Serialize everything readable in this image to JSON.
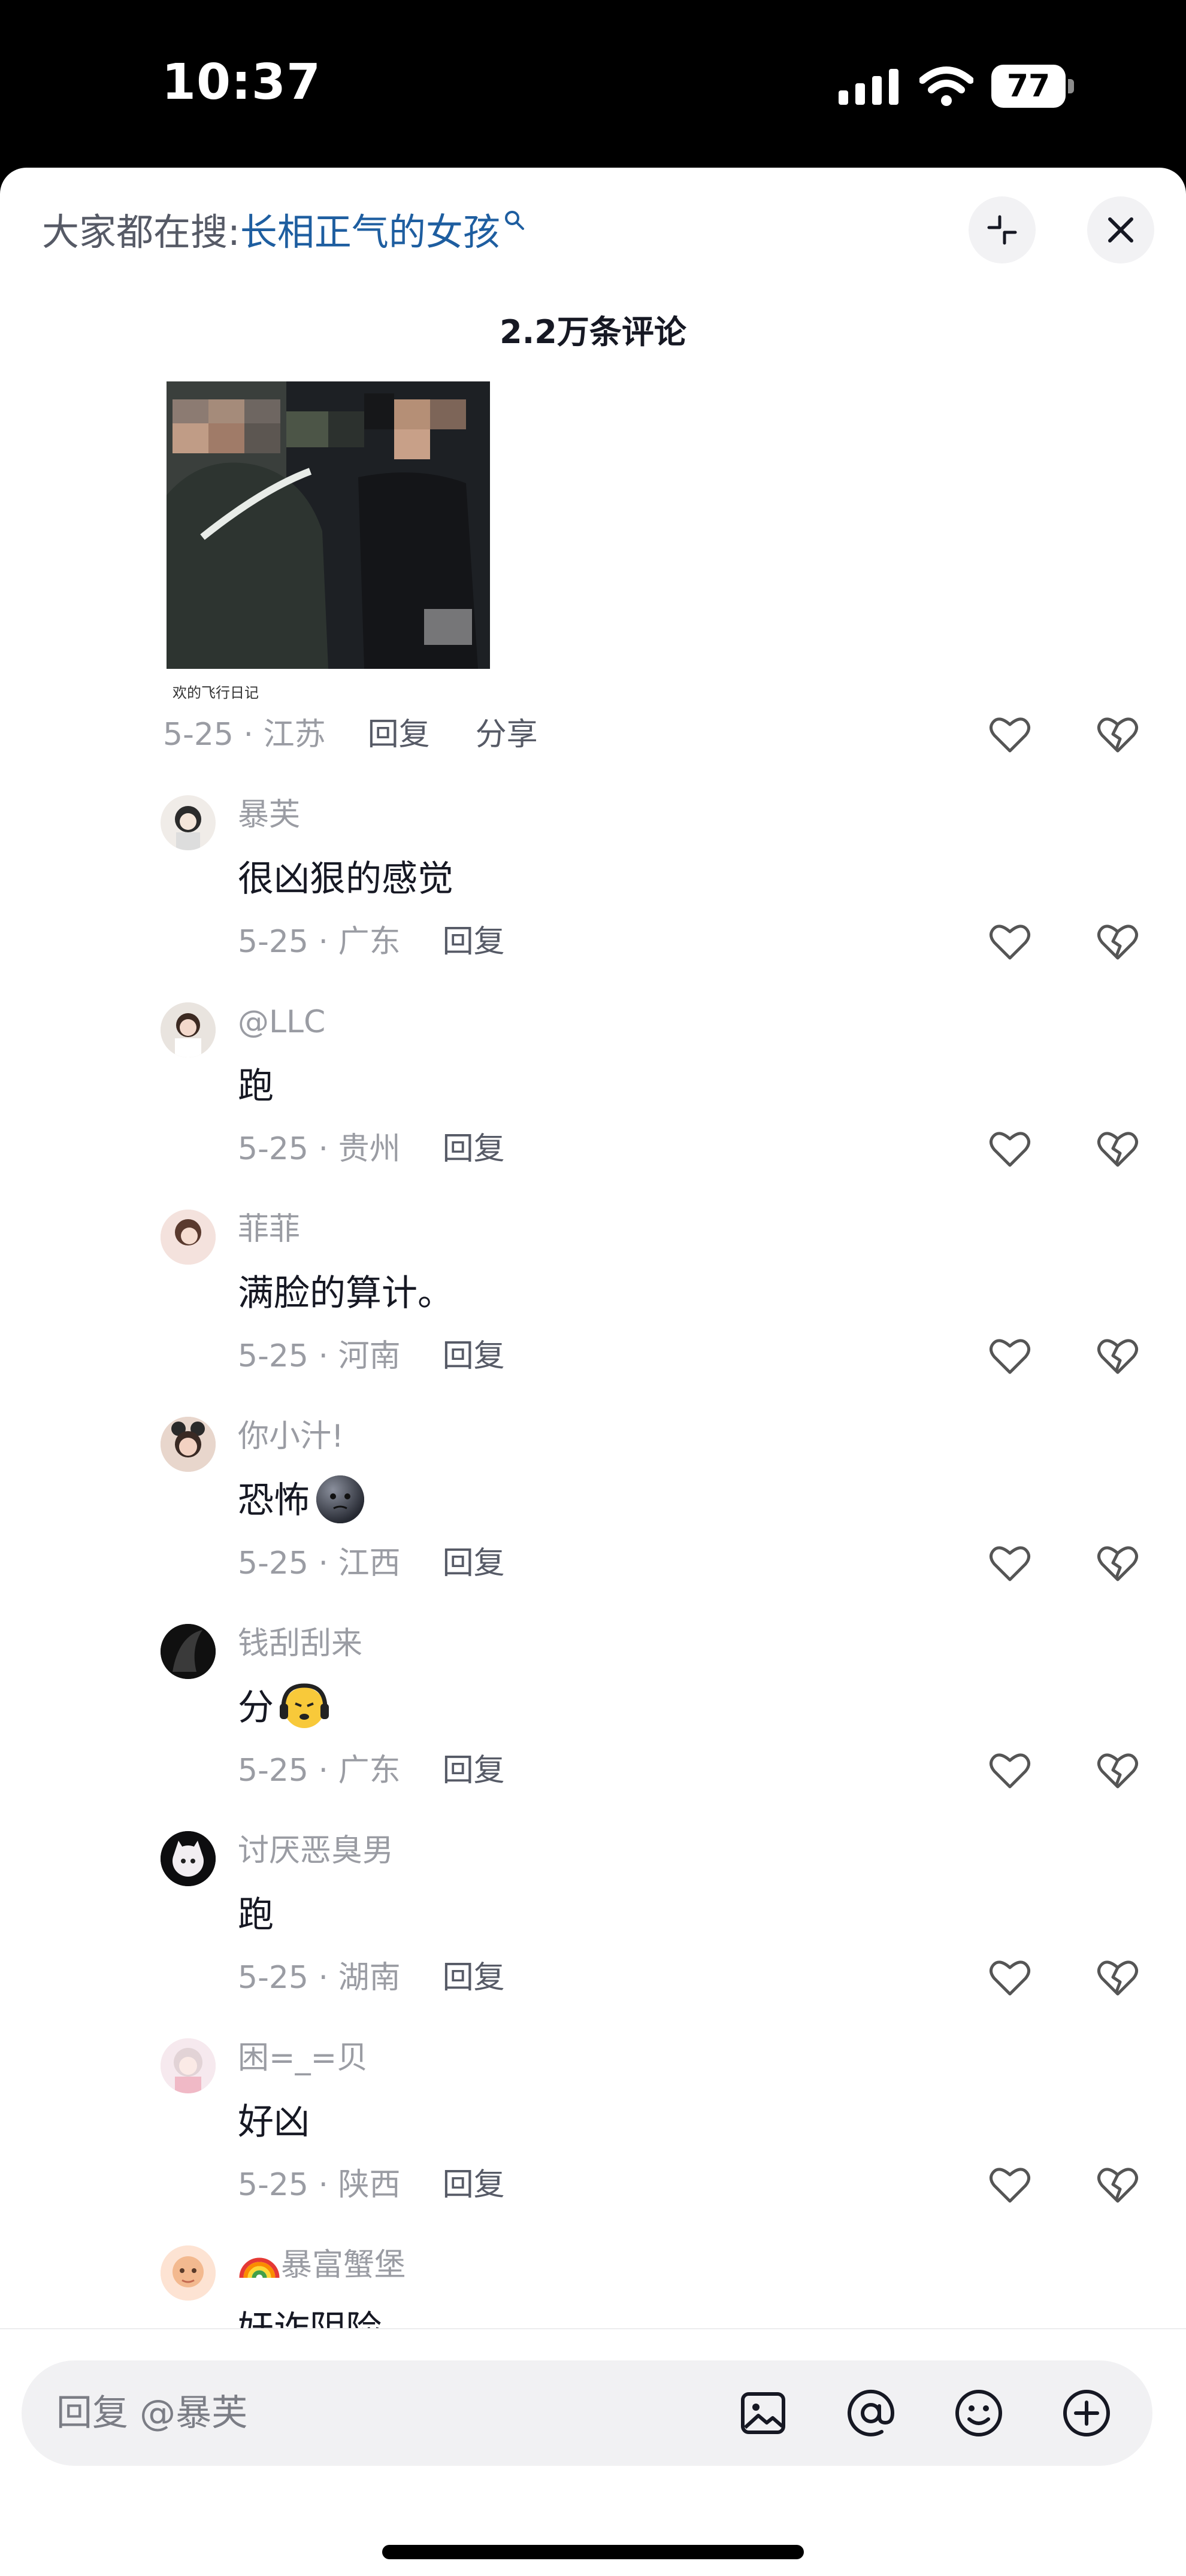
{
  "status": {
    "time": "10:37",
    "battery": "77"
  },
  "header": {
    "search_prefix": "大家都在搜:",
    "search_term": "长相正气的女孩",
    "comment_count": "2.2万条评论"
  },
  "main_comment": {
    "photo_caption": "欢的飞行日记",
    "date": "5-25 · 江苏",
    "reply_label": "回复",
    "share_label": "分享"
  },
  "replies": [
    {
      "name": "暴芙",
      "text": "很凶狠的感觉",
      "date": "5-25 · 广东",
      "reply_label": "回复"
    },
    {
      "name": "@LLC",
      "text": "跑",
      "date": "5-25 · 贵州",
      "reply_label": "回复"
    },
    {
      "name": "菲菲",
      "text": "满脸的算计。",
      "date": "5-25 · 河南",
      "reply_label": "回复"
    },
    {
      "name": "你小汁!",
      "text": "恐怖",
      "emoji": "dark-moon-face-emoji",
      "date": "5-25 · 江西",
      "reply_label": "回复"
    },
    {
      "name": "钱刮刮来",
      "text": "分",
      "emoji": "worried-face-with-headphones-emoji",
      "date": "5-25 · 广东",
      "reply_label": "回复"
    },
    {
      "name": "讨厌恶臭男",
      "text": "跑",
      "date": "5-25 · 湖南",
      "reply_label": "回复"
    },
    {
      "name": "困=_=贝",
      "text": "好凶",
      "date": "5-25 · 陕西",
      "reply_label": "回复"
    },
    {
      "name": "暴富蟹堡",
      "text": "奸诈阴险",
      "name_prefix_icon": "rainbow-icon"
    }
  ],
  "input": {
    "placeholder": "回复 @暴芙"
  },
  "icons": {
    "like": "heart-outline-icon",
    "dislike": "broken-heart-icon",
    "collapse": "collapse-icon",
    "close": "close-icon",
    "image": "image-icon",
    "mention": "at-icon",
    "emoji": "smile-icon",
    "add": "plus-circle-icon"
  },
  "colors": {
    "link_blue": "#1e5ea0",
    "muted": "#9a9ca3",
    "text": "#161823"
  }
}
